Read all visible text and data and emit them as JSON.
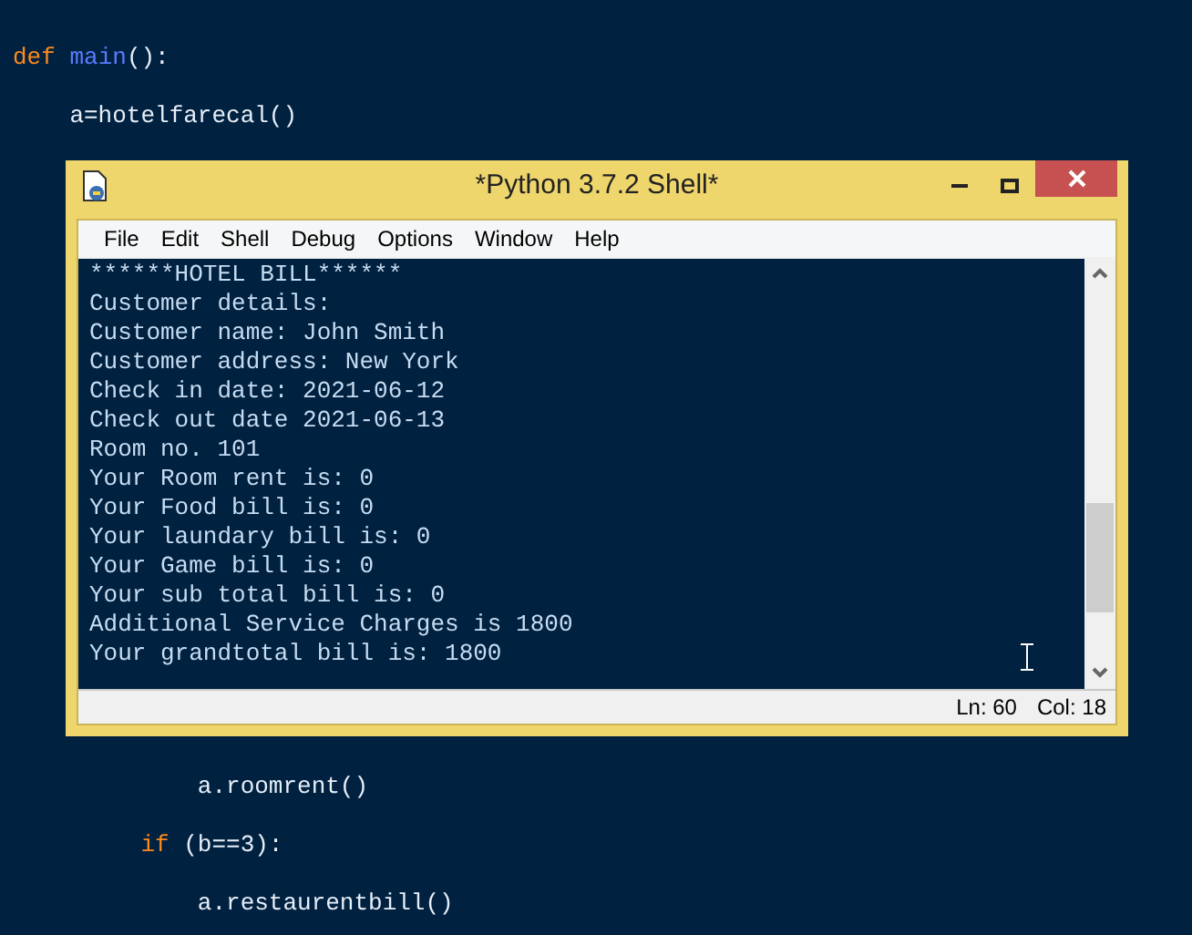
{
  "editor_top": [
    {
      "tokens": [
        {
          "kind": "keyword",
          "text": "def "
        },
        {
          "kind": "name",
          "text": "main"
        },
        {
          "kind": "plain",
          "text": "():"
        }
      ]
    },
    {
      "tokens": [
        {
          "kind": "plain",
          "text": "    a=hotelfarecal()"
        }
      ]
    }
  ],
  "window": {
    "title": "*Python 3.7.2 Shell*",
    "menu": [
      "File",
      "Edit",
      "Shell",
      "Debug",
      "Options",
      "Window",
      "Help"
    ],
    "output": [
      "******HOTEL BILL******",
      "Customer details:",
      "Customer name: John Smith",
      "Customer address: New York",
      "Check in date: 2021-06-12",
      "Check out date 2021-06-13",
      "Room no. 101",
      "Your Room rent is: 0",
      "Your Food bill is: 0",
      "Your laundary bill is: 0",
      "Your Game bill is: 0",
      "Your sub total bill is: 0",
      "Additional Service Charges is 1800",
      "Your grandtotal bill is: 1800"
    ],
    "status": {
      "line": "Ln: 60",
      "column": "Col: 18"
    }
  },
  "editor_bottom": [
    {
      "tokens": [
        {
          "kind": "plain",
          "text": "             a.roomrent()"
        }
      ]
    },
    {
      "tokens": [
        {
          "kind": "keyword",
          "text": "         if"
        },
        {
          "kind": "plain",
          "text": " (b==3):"
        }
      ]
    },
    {
      "tokens": [
        {
          "kind": "plain",
          "text": "             a.restaurentbill()"
        }
      ]
    }
  ]
}
